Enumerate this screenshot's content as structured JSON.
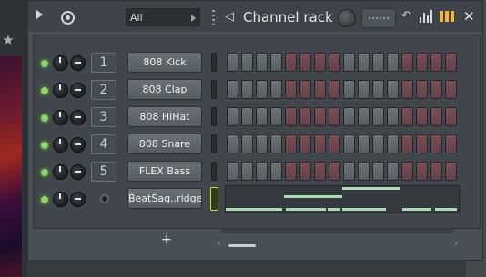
{
  "window": {
    "title": "Channel rack",
    "filter_value": "All",
    "add_label": "+"
  },
  "icons": {
    "play": "play-icon",
    "refresh": "refresh-icon",
    "speaker": "speaker-icon",
    "undo": "undo-icon",
    "graph": "graph-editor-icon",
    "pattern": "pattern-icon",
    "close": "close-icon"
  },
  "colors": {
    "led_on": "#8fd66a",
    "step_off": "#5f666a",
    "step_accent": "#6f474d",
    "note": "#a8dcb0",
    "selected_outline": "#bfe03a"
  },
  "channels": [
    {
      "number": "1",
      "name": "808 Kick"
    },
    {
      "number": "2",
      "name": "808 Clap"
    },
    {
      "number": "3",
      "name": "808 HiHat"
    },
    {
      "number": "4",
      "name": "808 Snare"
    },
    {
      "number": "5",
      "name": "FLEX Bass"
    },
    {
      "number": "",
      "name": "BeatSag..ridge"
    }
  ],
  "step_pattern": [
    "g",
    "g",
    "g",
    "g",
    "r",
    "r",
    "r",
    "r",
    "g",
    "g",
    "g",
    "g",
    "r",
    "r",
    "r",
    "r"
  ]
}
